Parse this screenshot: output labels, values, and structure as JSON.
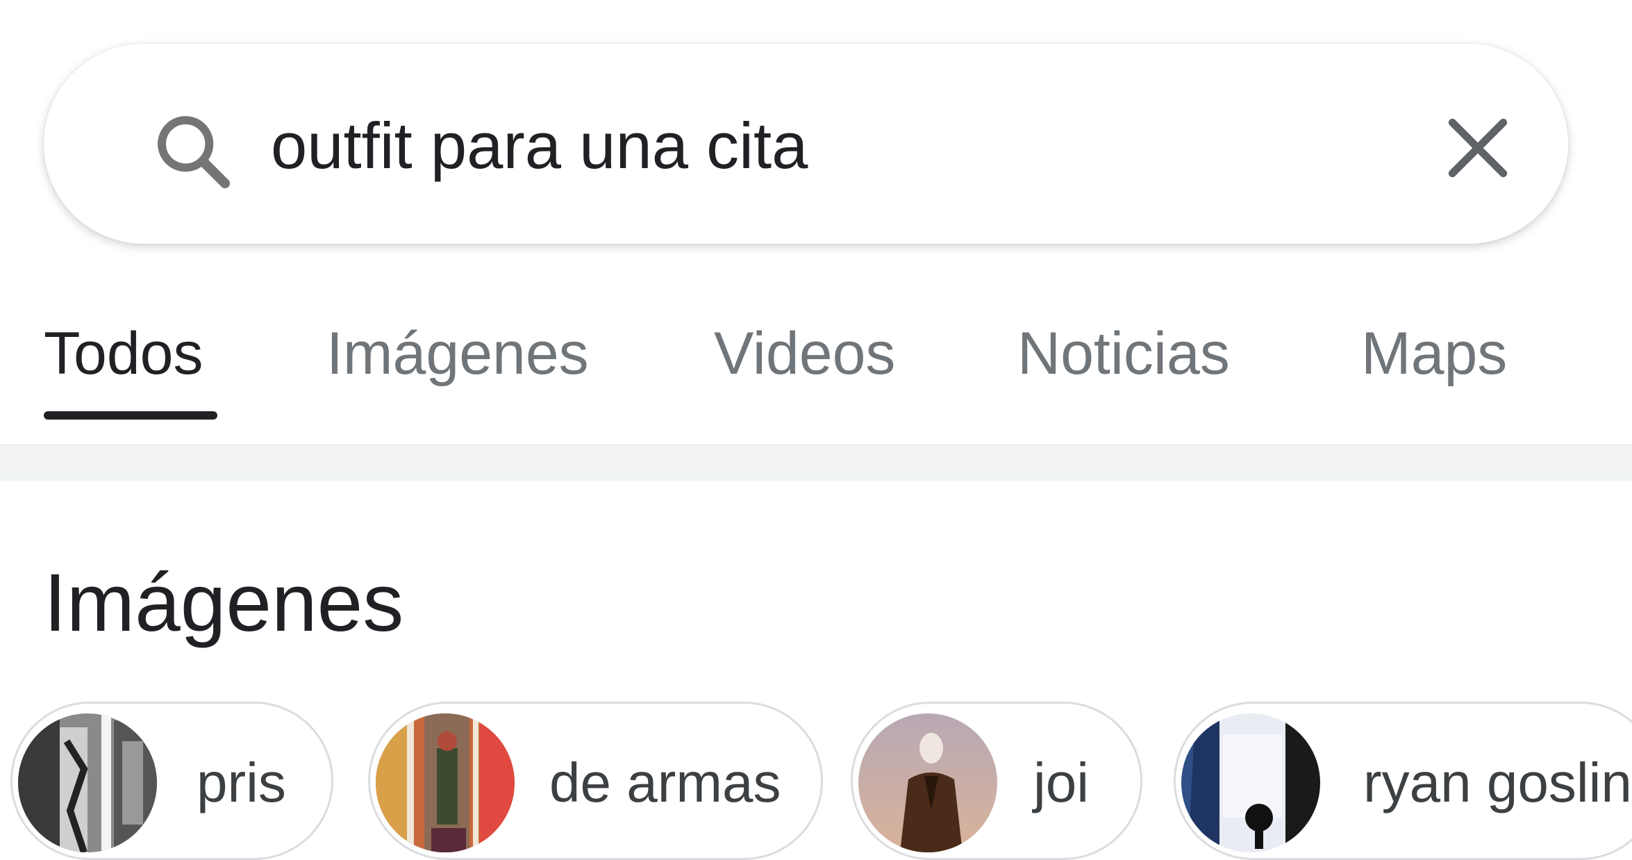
{
  "search": {
    "query": "outfit para una cita",
    "search_icon": "search-icon",
    "clear_icon": "close-icon"
  },
  "tabs": [
    {
      "label": "Todos",
      "active": true
    },
    {
      "label": "Imágenes",
      "active": false
    },
    {
      "label": "Videos",
      "active": false
    },
    {
      "label": "Noticias",
      "active": false
    },
    {
      "label": "Maps",
      "active": false
    }
  ],
  "images_section": {
    "title": "Imágenes",
    "chips": [
      {
        "label": "pris"
      },
      {
        "label": "de armas"
      },
      {
        "label": "joi"
      },
      {
        "label": "ryan gosling"
      }
    ]
  },
  "colors": {
    "active_tab_text": "#202124",
    "inactive_tab_text": "#70757a",
    "chip_border": "#dadce0",
    "divider_band": "#f1f3f4"
  }
}
